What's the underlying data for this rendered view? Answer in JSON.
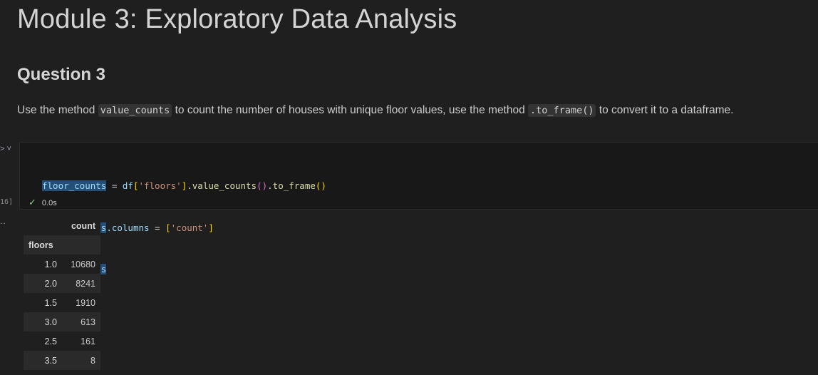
{
  "notebook": {
    "title": "Module 3: Exploratory Data Analysis",
    "subtitle": "Question 3",
    "instruction": {
      "part1": "Use the method ",
      "code1": "value_counts",
      "part2": " to count the number of houses with unique floor values, use the method ",
      "code2": ".to_frame()",
      "part3": " to convert it to a dataframe."
    }
  },
  "cell": {
    "run_icon": "> ˅",
    "exec_count": "16]",
    "code": {
      "var": "floor_counts",
      "line1_assign": " = ",
      "line1_df": "df",
      "line1_key": "'floors'",
      "line1_method1": "value_counts",
      "line1_method2": "to_frame",
      "line2_attr": ".columns",
      "line2_value": "'count'"
    },
    "status_text": "0.0s",
    "status_icon": "check-icon"
  },
  "output": {
    "dots": "..",
    "column_header": "count",
    "index_name": "floors",
    "rows": [
      {
        "floors": "1.0",
        "count": "10680"
      },
      {
        "floors": "2.0",
        "count": "8241"
      },
      {
        "floors": "1.5",
        "count": "1910"
      },
      {
        "floors": "3.0",
        "count": "613"
      },
      {
        "floors": "2.5",
        "count": "161"
      },
      {
        "floors": "3.5",
        "count": "8"
      }
    ]
  }
}
